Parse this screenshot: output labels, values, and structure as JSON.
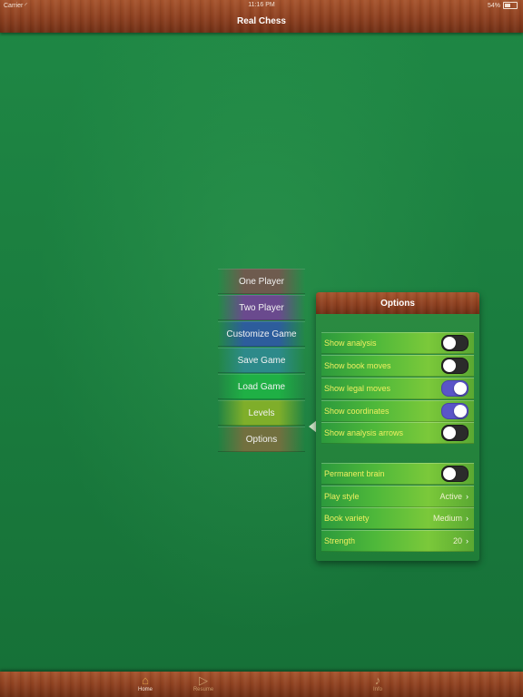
{
  "status_bar": {
    "carrier": "Carrier",
    "time": "11:16 PM",
    "battery": "54%",
    "battery_level": 0.54
  },
  "nav": {
    "title": "Real Chess"
  },
  "menu": {
    "items": [
      {
        "label": "One Player"
      },
      {
        "label": "Two Player"
      },
      {
        "label": "Customize Game"
      },
      {
        "label": "Save Game"
      },
      {
        "label": "Load Game"
      },
      {
        "label": "Levels"
      },
      {
        "label": "Options"
      }
    ]
  },
  "options": {
    "title": "Options",
    "rows": [
      {
        "label": "Show analysis",
        "type": "toggle",
        "on": false
      },
      {
        "label": "Show book moves",
        "type": "toggle",
        "on": false
      },
      {
        "label": "Show legal moves",
        "type": "toggle",
        "on": true
      },
      {
        "label": "Show coordinates",
        "type": "toggle",
        "on": true
      },
      {
        "label": "Show analysis arrows",
        "type": "toggle",
        "on": false
      },
      {
        "label": "Permanent brain",
        "type": "toggle",
        "on": false
      },
      {
        "label": "Play style",
        "type": "value",
        "value": "Active"
      },
      {
        "label": "Book variety",
        "type": "value",
        "value": "Medium"
      },
      {
        "label": "Strength",
        "type": "value",
        "value": "20"
      }
    ]
  },
  "tabbar": {
    "tabs": [
      {
        "label": "Home",
        "icon": "home-icon",
        "active": true
      },
      {
        "label": "Resume",
        "icon": "play-icon",
        "active": false
      },
      {
        "label": "Info",
        "icon": "music-note-icon",
        "active": false
      }
    ]
  },
  "colors": {
    "felt": "#1d7a3f",
    "wood": "#8c3f1f",
    "toggle_on": "#5a55c8",
    "label_yellow": "#f0f060"
  }
}
